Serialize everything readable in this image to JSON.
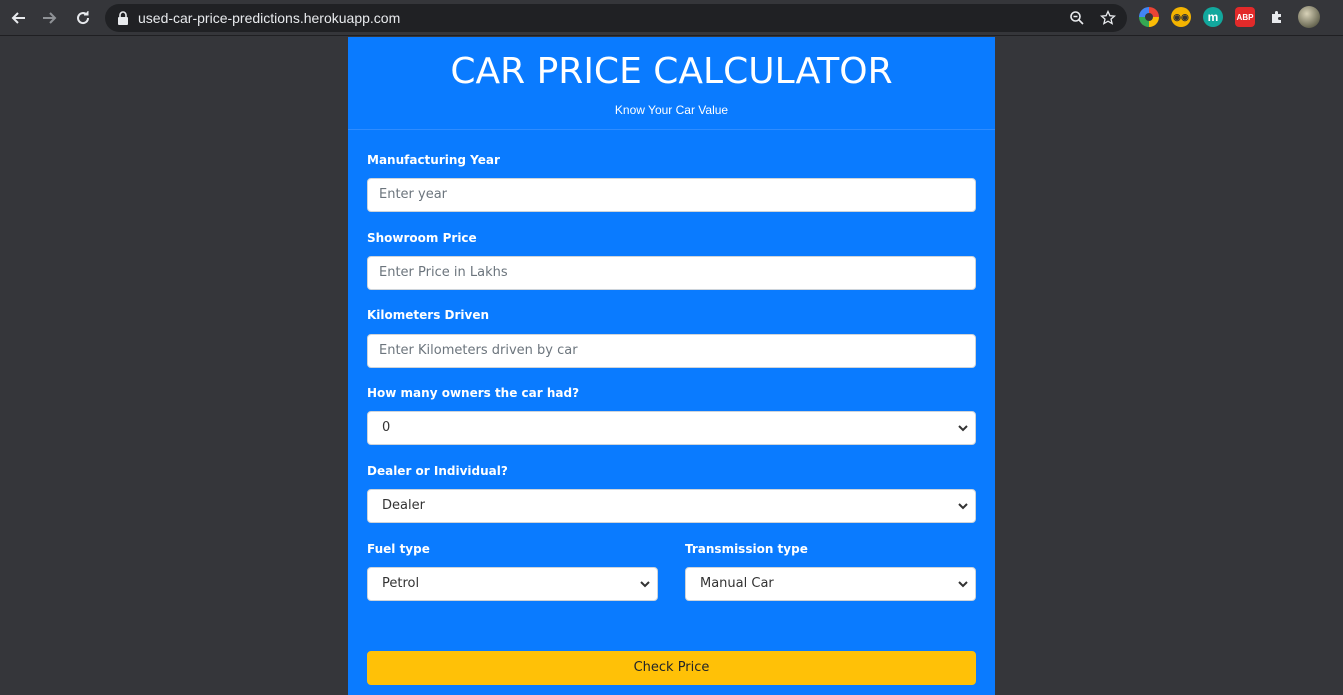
{
  "browser": {
    "url": "used-car-price-predictions.herokuapp.com",
    "extensions": [
      {
        "name": "color-wheel-extension",
        "bg": "#e8eaed"
      },
      {
        "name": "eyes-extension",
        "bg": "#f4b400"
      },
      {
        "name": "m-extension",
        "label": "m",
        "bg": "#12a89d"
      },
      {
        "name": "abp-extension",
        "label": "ABP",
        "bg": "#e22a2a"
      }
    ]
  },
  "header": {
    "title": "CAR PRICE CALCULATOR",
    "subtitle": "Know Your Car Value"
  },
  "form": {
    "year": {
      "label": "Manufacturing Year",
      "placeholder": "Enter year"
    },
    "price": {
      "label": "Showroom Price",
      "placeholder": "Enter Price in Lakhs"
    },
    "km": {
      "label": "Kilometers Driven",
      "placeholder": "Enter Kilometers driven by car"
    },
    "owners": {
      "label": "How many owners the car had?",
      "value": "0"
    },
    "seller": {
      "label": "Dealer or Individual?",
      "value": "Dealer"
    },
    "fuel": {
      "label": "Fuel type",
      "value": "Petrol"
    },
    "transmission": {
      "label": "Transmission type",
      "value": "Manual Car"
    },
    "submit_label": "Check Price"
  },
  "colors": {
    "card": "#0a7bff",
    "button": "#ffc107",
    "page": "#35363a"
  }
}
